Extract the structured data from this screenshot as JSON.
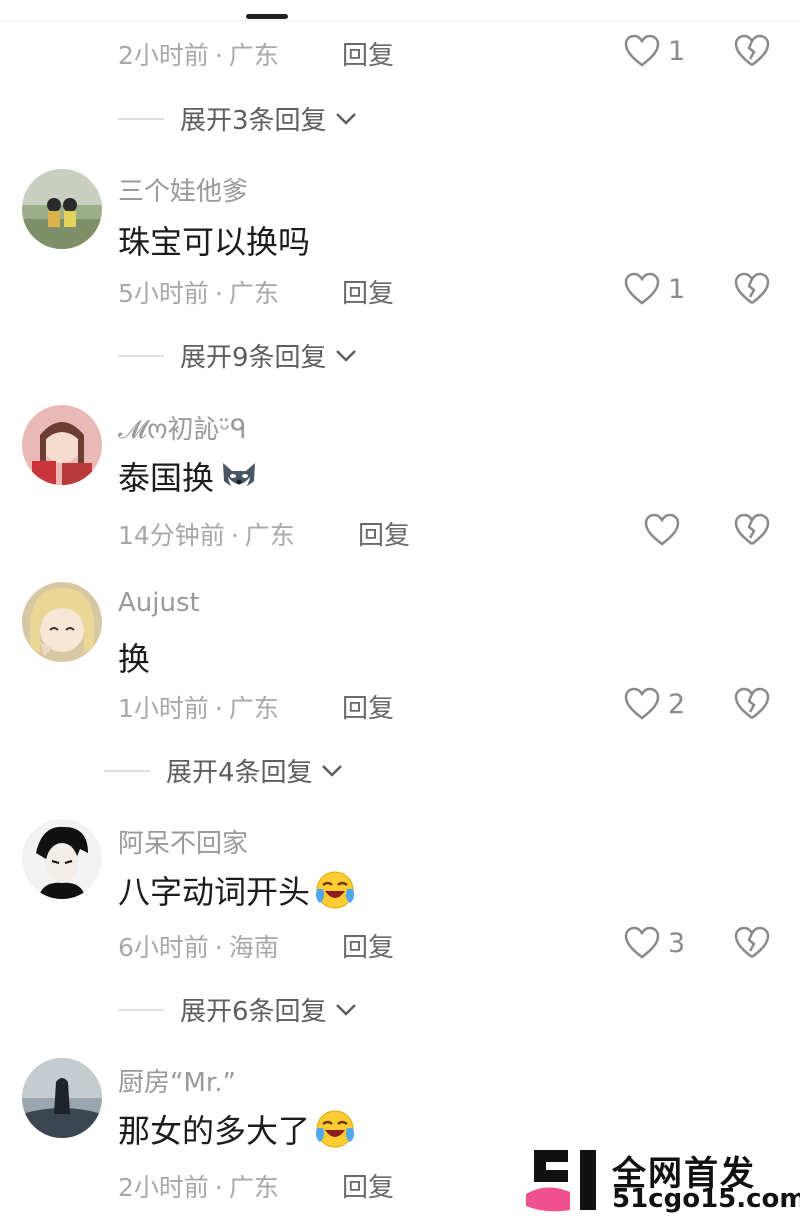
{
  "comments": [
    {
      "username": "",
      "text": "",
      "time": "2小时前",
      "location": "广东",
      "reply_label": "回复",
      "likes": "1",
      "expand_label": "展开3条回复"
    },
    {
      "username": "三个娃他爹",
      "text": "珠宝可以换吗",
      "time": "5小时前",
      "location": "广东",
      "reply_label": "回复",
      "likes": "1",
      "expand_label": "展开9条回复"
    },
    {
      "username": "𝓜ო初訫ᵕ̈ᑫ",
      "text": "泰国换",
      "time": "14分钟前",
      "location": "广东",
      "reply_label": "回复",
      "likes": "",
      "expand_label": ""
    },
    {
      "username": "Aujust",
      "text": "换",
      "time": "1小时前",
      "location": "广东",
      "reply_label": "回复",
      "likes": "2",
      "expand_label": "展开4条回复"
    },
    {
      "username": "阿呆不回家",
      "text": "八字动词开头",
      "time": "6小时前",
      "location": "海南",
      "reply_label": "回复",
      "likes": "3",
      "expand_label": "展开6条回复"
    },
    {
      "username": "厨房“Mr.”",
      "text": "那女的多大了",
      "time": "2小时前",
      "location": "广东",
      "reply_label": "回复",
      "likes": "",
      "expand_label": ""
    }
  ],
  "separator": "·",
  "icons": {
    "like": "heart-outline-icon",
    "dislike": "broken-heart-icon",
    "expand": "chevron-down-icon"
  },
  "watermark": {
    "title": "全网首发",
    "url": "51cgo15.com"
  },
  "colors": {
    "meta": "#a8a8a8",
    "username": "#9a9a9a",
    "text": "#1c1c1c",
    "watermark_pink": "#f0508c"
  }
}
